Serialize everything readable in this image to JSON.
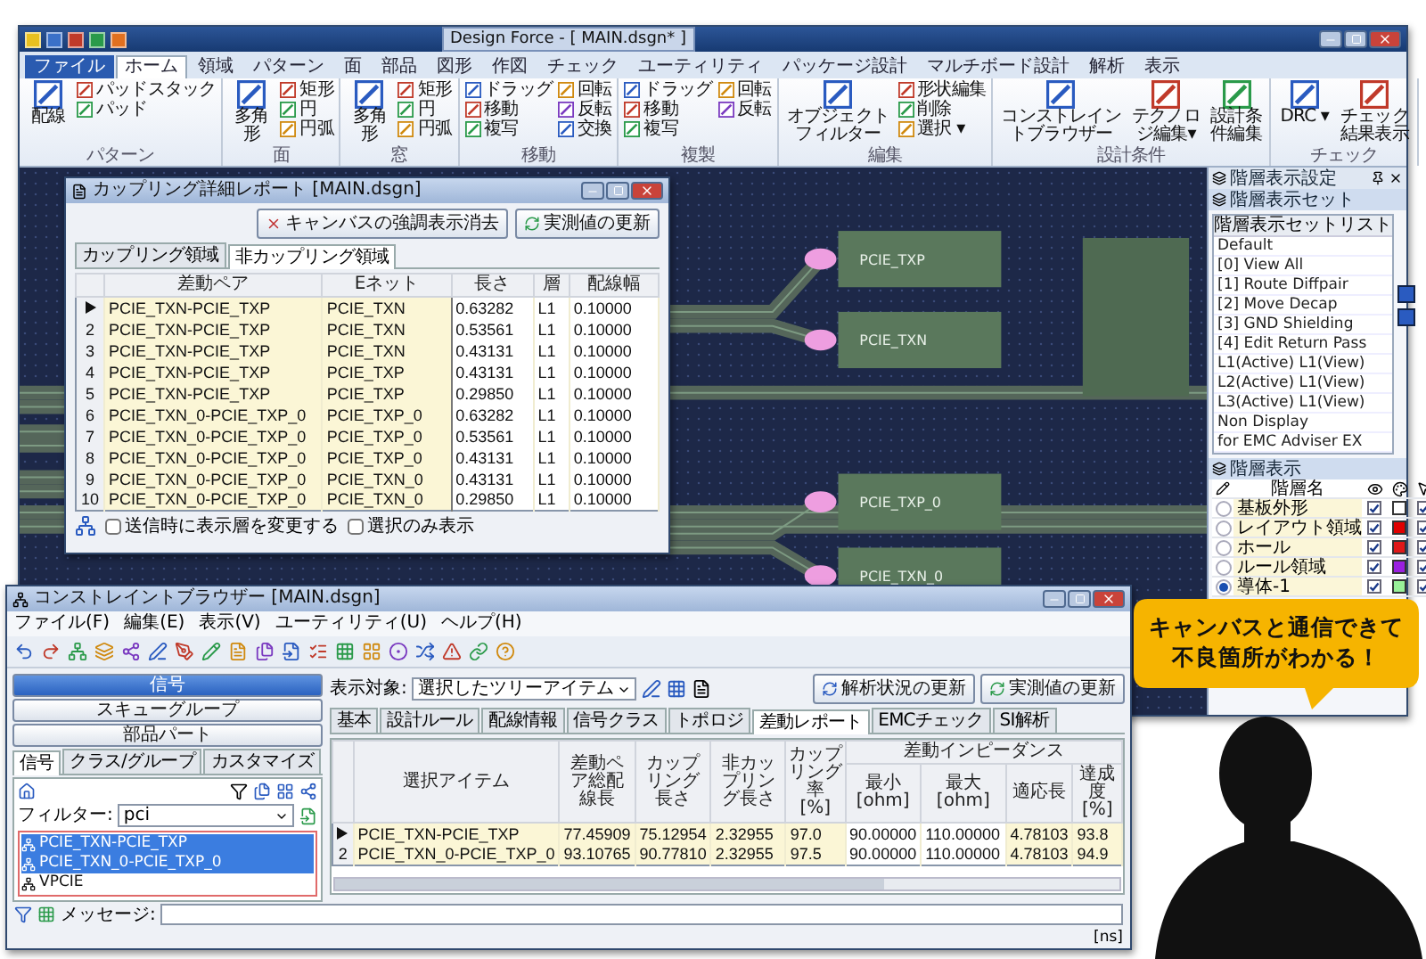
{
  "main_window": {
    "title": "Design Force - [ MAIN.dsgn* ]"
  },
  "ribbon_tabs": [
    {
      "label": "ファイル",
      "kind": "file",
      "selected": false
    },
    {
      "label": "ホーム",
      "kind": "tab",
      "selected": true
    },
    {
      "label": "領域",
      "kind": "tab",
      "selected": false
    },
    {
      "label": "パターン",
      "kind": "tab",
      "selected": false
    },
    {
      "label": "面",
      "kind": "tab",
      "selected": false
    },
    {
      "label": "部品",
      "kind": "tab",
      "selected": false
    },
    {
      "label": "図形",
      "kind": "tab",
      "selected": false
    },
    {
      "label": "作図",
      "kind": "tab",
      "selected": false
    },
    {
      "label": "チェック",
      "kind": "tab",
      "selected": false
    },
    {
      "label": "ユーティリティ",
      "kind": "tab",
      "selected": false
    },
    {
      "label": "パッケージ設計",
      "kind": "tab",
      "selected": false
    },
    {
      "label": "マルチボード設計",
      "kind": "tab",
      "selected": false
    },
    {
      "label": "解析",
      "kind": "tab",
      "selected": false
    },
    {
      "label": "表示",
      "kind": "tab",
      "selected": false
    }
  ],
  "ribbon_groups": [
    {
      "label": "パターン",
      "items": [
        {
          "label": "配線",
          "kind": "large"
        },
        {
          "label": "パッドスタック",
          "kind": "small"
        },
        {
          "label": "パッド",
          "kind": "small"
        }
      ]
    },
    {
      "label": "面",
      "items": [
        {
          "label": "多角形",
          "kind": "large"
        },
        {
          "label": "矩形",
          "kind": "small"
        },
        {
          "label": "円",
          "kind": "small"
        },
        {
          "label": "円弧",
          "kind": "small"
        }
      ]
    },
    {
      "label": "窓",
      "items": [
        {
          "label": "多角形",
          "kind": "large"
        },
        {
          "label": "矩形",
          "kind": "small"
        },
        {
          "label": "円",
          "kind": "small"
        },
        {
          "label": "円弧",
          "kind": "small"
        }
      ]
    },
    {
      "label": "移動",
      "items": [
        {
          "label": "ドラッグ",
          "kind": "small"
        },
        {
          "label": "移動",
          "kind": "small"
        },
        {
          "label": "複写",
          "kind": "small"
        },
        {
          "label": "回転",
          "kind": "small"
        },
        {
          "label": "反転",
          "kind": "small"
        },
        {
          "label": "交換",
          "kind": "small"
        }
      ]
    },
    {
      "label": "複製",
      "items": [
        {
          "label": "ドラッグ",
          "kind": "small"
        },
        {
          "label": "移動",
          "kind": "small"
        },
        {
          "label": "複写",
          "kind": "small"
        },
        {
          "label": "回転",
          "kind": "small"
        },
        {
          "label": "反転",
          "kind": "small"
        }
      ]
    },
    {
      "label": "編集",
      "items": [
        {
          "label": "オブジェクトフィルター",
          "kind": "large"
        },
        {
          "label": "形状編集",
          "kind": "small"
        },
        {
          "label": "削除",
          "kind": "small"
        },
        {
          "label": "選択 ▾",
          "kind": "small"
        }
      ]
    },
    {
      "label": "設計条件",
      "items": [
        {
          "label": "コンストレイントブラウザー",
          "kind": "large"
        },
        {
          "label": "テクノロジ編集▾",
          "kind": "large"
        },
        {
          "label": "設計条件編集",
          "kind": "large"
        }
      ]
    },
    {
      "label": "チェック",
      "items": [
        {
          "label": "DRC ▾",
          "kind": "large"
        },
        {
          "label": "チェック結果表示",
          "kind": "large"
        }
      ]
    }
  ],
  "canvas": {
    "parts": [
      {
        "label": "PCIE_TXP"
      },
      {
        "label": "PCIE_TXN"
      },
      {
        "label": "PCIE_TXP_0"
      },
      {
        "label": "PCIE_TXN_0"
      }
    ]
  },
  "layer_panel": {
    "title": "階層表示設定",
    "set_title": "階層表示セット",
    "list_header": "階層表示セットリスト",
    "sets": [
      "Default",
      "[0] View All",
      "[1] Route Diffpair",
      "[2] Move Decap",
      "[3] GND Shielding",
      "[4] Edit Return Pass",
      "L1(Active) L1(View)",
      "L2(Active) L1(View)",
      "L3(Active) L1(View)",
      "Non Display",
      "for EMC Adviser EX"
    ],
    "layers_title": "階層表示",
    "name_header": "階層名",
    "layers": [
      {
        "name": "基板外形",
        "active": false,
        "visible": true,
        "color": "#ffffff",
        "selectable": true
      },
      {
        "name": "レイアウト領域",
        "active": false,
        "visible": true,
        "color": "#e00000",
        "selectable": true
      },
      {
        "name": "ホール",
        "active": false,
        "visible": true,
        "color": "#e01818",
        "selectable": true
      },
      {
        "name": "ルール領域",
        "active": false,
        "visible": true,
        "color": "#9a20e0",
        "selectable": true
      },
      {
        "name": "導体-1",
        "active": true,
        "visible": true,
        "color": "#98f098",
        "selectable": true
      }
    ]
  },
  "coupling_window": {
    "title": "カップリング詳細レポート [MAIN.dsgn]",
    "buttons": [
      "キャンバスの強調表示消去",
      "実測値の更新"
    ],
    "tabs": [
      {
        "label": "カップリング領域",
        "selected": false
      },
      {
        "label": "非カップリング領域",
        "selected": true
      }
    ],
    "columns": [
      "差動ペア",
      "Eネット",
      "長さ",
      "層",
      "配線幅"
    ],
    "rows": [
      {
        "current": true,
        "cells": [
          "PCIE_TXN-PCIE_TXP",
          "PCIE_TXN",
          "0.63282",
          "L1",
          "0.10000"
        ]
      },
      {
        "no": "2",
        "current": false,
        "cells": [
          "PCIE_TXN-PCIE_TXP",
          "PCIE_TXN",
          "0.53561",
          "L1",
          "0.10000"
        ]
      },
      {
        "no": "3",
        "current": false,
        "cells": [
          "PCIE_TXN-PCIE_TXP",
          "PCIE_TXN",
          "0.43131",
          "L1",
          "0.10000"
        ]
      },
      {
        "no": "4",
        "current": false,
        "cells": [
          "PCIE_TXN-PCIE_TXP",
          "PCIE_TXP",
          "0.43131",
          "L1",
          "0.10000"
        ]
      },
      {
        "no": "5",
        "current": false,
        "cells": [
          "PCIE_TXN-PCIE_TXP",
          "PCIE_TXP",
          "0.29850",
          "L1",
          "0.10000"
        ]
      },
      {
        "no": "6",
        "current": false,
        "cells": [
          "PCIE_TXN_0-PCIE_TXP_0",
          "PCIE_TXP_0",
          "0.63282",
          "L1",
          "0.10000"
        ]
      },
      {
        "no": "7",
        "current": false,
        "cells": [
          "PCIE_TXN_0-PCIE_TXP_0",
          "PCIE_TXP_0",
          "0.53561",
          "L1",
          "0.10000"
        ]
      },
      {
        "no": "8",
        "current": false,
        "cells": [
          "PCIE_TXN_0-PCIE_TXP_0",
          "PCIE_TXP_0",
          "0.43131",
          "L1",
          "0.10000"
        ]
      },
      {
        "no": "9",
        "current": false,
        "cells": [
          "PCIE_TXN_0-PCIE_TXP_0",
          "PCIE_TXN_0",
          "0.43131",
          "L1",
          "0.10000"
        ]
      },
      {
        "no": "10",
        "current": false,
        "cells": [
          "PCIE_TXN_0-PCIE_TXP_0",
          "PCIE_TXN_0",
          "0.29850",
          "L1",
          "0.10000"
        ]
      }
    ],
    "options": [
      {
        "label": "送信時に表示層を変更する",
        "checked": false
      },
      {
        "label": "選択のみ表示",
        "checked": false
      }
    ]
  },
  "constraint_browser": {
    "title": "コンストレイントブラウザー [MAIN.dsgn]",
    "menu": [
      "ファイル(F)",
      "編集(E)",
      "表示(V)",
      "ユーティリティ(U)",
      "ヘルプ(H)"
    ],
    "modes": [
      {
        "label": "信号",
        "selected": true
      },
      {
        "label": "スキューグループ",
        "selected": false
      },
      {
        "label": "部品パート",
        "selected": false
      }
    ],
    "tabs": [
      {
        "label": "信号",
        "selected": true
      },
      {
        "label": "クラス/グループ",
        "selected": false
      },
      {
        "label": "カスタマイズ",
        "selected": false
      }
    ],
    "filter_label": "フィルター:",
    "filter_value": "pci",
    "tree": [
      {
        "label": "PCIE_TXN-PCIE_TXP",
        "selected": true
      },
      {
        "label": "PCIE_TXN_0-PCIE_TXP_0",
        "selected": true
      },
      {
        "label": "VPCIE",
        "selected": false
      }
    ],
    "target_label": "表示対象:",
    "target_value": "選択したツリーアイテム",
    "buttons": [
      "解析状況の更新",
      "実測値の更新"
    ],
    "report_tabs": [
      {
        "label": "基本",
        "selected": false
      },
      {
        "label": "設計ルール",
        "selected": false
      },
      {
        "label": "配線情報",
        "selected": false
      },
      {
        "label": "信号クラス",
        "selected": false
      },
      {
        "label": "トポロジ",
        "selected": false
      },
      {
        "label": "差動レポート",
        "selected": true
      },
      {
        "label": "EMCチェック",
        "selected": false
      },
      {
        "label": "SI解析",
        "selected": false
      }
    ],
    "columns": [
      "選択アイテム",
      "差動ペア総配線長",
      "カップリング長さ",
      "非カップリング長さ",
      "カップリング率 [%]"
    ],
    "group_header": "差動インピーダンス",
    "sub_columns": [
      "最小 [ohm]",
      "最大 [ohm]",
      "適応長",
      "達成度 [%]"
    ],
    "rows": [
      {
        "current": true,
        "cells": [
          "PCIE_TXN-PCIE_TXP",
          "77.45909",
          "75.12954",
          "2.32955",
          "97.0",
          "90.00000",
          "110.00000",
          "4.78103",
          "93.8"
        ]
      },
      {
        "no": "2",
        "current": false,
        "cells": [
          "PCIE_TXN_0-PCIE_TXP_0",
          "93.10765",
          "90.77810",
          "2.32955",
          "97.5",
          "90.00000",
          "110.00000",
          "4.78103",
          "94.9"
        ]
      }
    ],
    "message_label": "メッセージ:",
    "status": "[ns]"
  },
  "callout": {
    "lines": [
      "キャンバスと通信できて",
      "不良箇所がわかる！"
    ]
  }
}
